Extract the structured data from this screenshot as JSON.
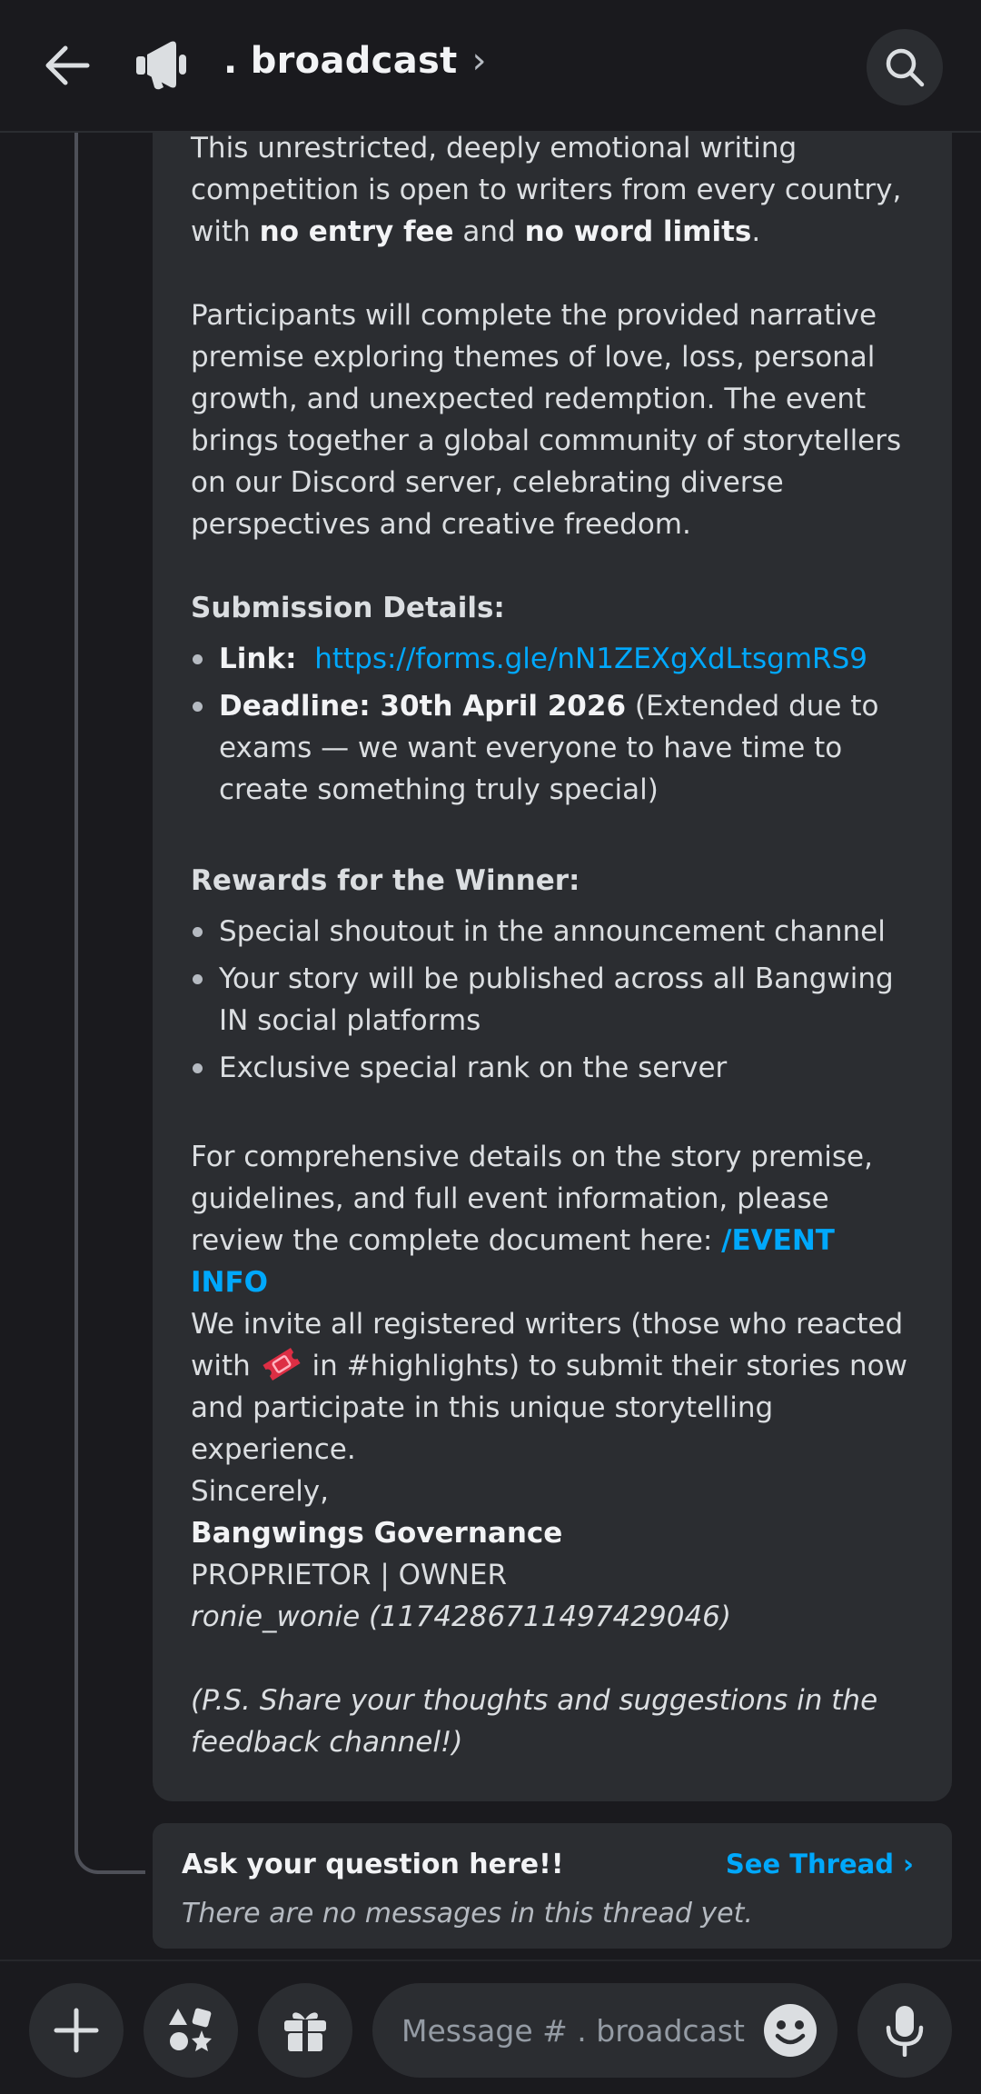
{
  "header": {
    "channel_name": ". broadcast",
    "chevron": "›",
    "back_icon": "arrow-left-icon",
    "channel_icon": "megaphone-icon",
    "search_icon": "search-icon"
  },
  "message": {
    "intro_part1": "This unrestricted, deeply emotional writing competition is open to writers from every country, with ",
    "intro_bold1": "no entry fee",
    "intro_and": " and ",
    "intro_bold2": "no word limits",
    "intro_end": ".",
    "premise": "Participants will complete the provided narrative premise exploring themes of love, loss, personal growth, and unexpected redemption. The event brings together a global community of storytellers on our Discord server, celebrating diverse perspectives and creative freedom.",
    "submission_heading": "Submission Details:",
    "link_label": "Link:",
    "link_url": "https://forms.gle/nN1ZEXgXdLtsgmRS9",
    "deadline_label": "Deadline: 30th April 2026",
    "deadline_note": " (Extended due to exams — we want everyone to have time to create something truly special)",
    "rewards_heading": "Rewards for the Winner:",
    "rewards": [
      "Special shoutout in the announcement channel",
      "Your story will be published across all Bangwing IN social platforms",
      "Exclusive special rank on the server"
    ],
    "details_text": "For comprehensive details on the story premise, guidelines, and full event information, please review the complete document here: ",
    "event_info_mention": "/EVENT INFO",
    "invite_part1": "We invite all registered writers (those who reacted with ",
    "invite_part2": " in #highlights) to submit their stories now and participate in this unique storytelling experience.",
    "ticket_emoji_icon": "ticket-icon",
    "sign_off": "Sincerely,",
    "org_name": "Bangwings Governance",
    "role": "PROPRIETOR | OWNER",
    "username": "ronie_wonie (1174286711497429046)",
    "ps": "(P.S. Share your thoughts and suggestions in the feedback channel!)"
  },
  "thread": {
    "title": "Ask your question here!!",
    "see_thread": "See Thread ›",
    "empty": "There are no messages in this thread yet."
  },
  "composer": {
    "placeholder": "Message # . broadcast",
    "add_icon": "plus-icon",
    "apps_icon": "apps-icon",
    "gift_icon": "gift-icon",
    "emoji_icon": "emoji-icon",
    "mic_icon": "microphone-icon"
  },
  "colors": {
    "background": "#1a1a1e",
    "card": "#2b2d31",
    "link": "#00a8fc",
    "text": "#dbdee1"
  }
}
